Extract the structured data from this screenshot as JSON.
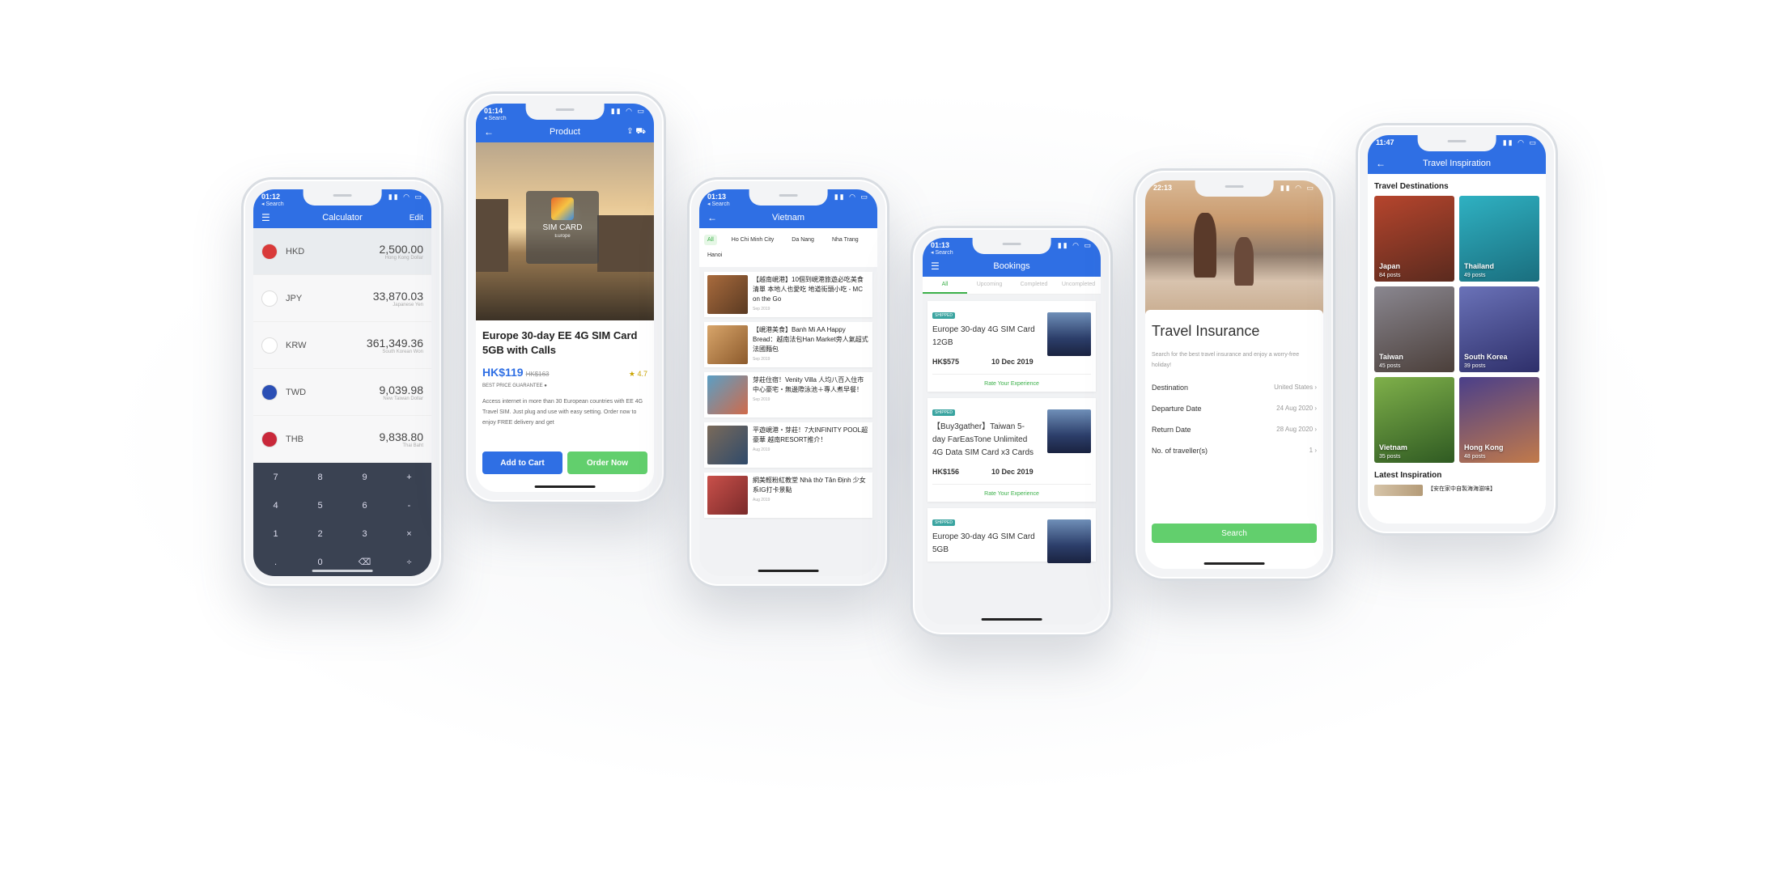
{
  "calculator": {
    "status_time": "01:12",
    "status_sub": "◂ Search",
    "title": "Calculator",
    "edit_label": "Edit",
    "rows": [
      {
        "code": "HKD",
        "amount": "2,500.00",
        "caption": "Hong Kong Dollar",
        "color": "#d93a3a"
      },
      {
        "code": "JPY",
        "amount": "33,870.03",
        "caption": "Japanese Yen",
        "color": "#ffffff"
      },
      {
        "code": "KRW",
        "amount": "361,349.36",
        "caption": "South Korean Won",
        "color": "#ffffff"
      },
      {
        "code": "TWD",
        "amount": "9,039.98",
        "caption": "New Taiwan Dollar",
        "color": "#2b4fb5"
      },
      {
        "code": "THB",
        "amount": "9,838.80",
        "caption": "Thai Baht",
        "color": "#c9283a"
      }
    ],
    "keys": [
      "7",
      "8",
      "9",
      "+",
      "4",
      "5",
      "6",
      "-",
      "1",
      "2",
      "3",
      "×",
      ".",
      "0",
      "⌫",
      "÷"
    ]
  },
  "product": {
    "status_time": "01:14",
    "status_sub": "◂ Search",
    "title": "Product",
    "sim_label": "SIM CARD",
    "sim_sub": "Europe",
    "name": "Europe 30-day EE 4G SIM Card 5GB with Calls",
    "price": "HK$119",
    "old_price": "HK$163",
    "rating": "★ 4.7",
    "guarantee": "BEST PRICE GUARANTEE",
    "description": "Access internet in more than 30 European countries with EE 4G Travel SIM. Just plug and use with easy setting. Order now to enjoy FREE delivery and get",
    "add_to_cart": "Add to Cart",
    "order_now": "Order Now",
    "colors": {
      "add": "#2f6fe4",
      "order": "#62cf6d"
    }
  },
  "vietnam": {
    "status_time": "01:13",
    "status_sub": "◂ Search",
    "title": "Vietnam",
    "chips": [
      "All",
      "Ho Chi Minh City",
      "Da Nang",
      "Nha Trang",
      "Hanoi"
    ],
    "articles": [
      {
        "title": "【越南峴港】10個到峴港旅遊必吃美食清單 本地人也愛吃 地道街頭小吃 - MC on the Go",
        "date": "Sep 2019"
      },
      {
        "title": "【峴港美食】Banh Mi AA Happy Bread：越南法包Han Market旁人氣超式法國麵包",
        "date": "Sep 2019"
      },
      {
        "title": "芽莊住宿！Venity Villa 人均八百入住市中心豪宅・無邊際泳池＋專人煮早餐！",
        "date": "Sep 2019"
      },
      {
        "title": "平遊峴港・芽莊！7大INFINITY POOL超豪華 越南RESORT推介！",
        "date": "Aug 2019"
      },
      {
        "title": "網美輕粉紅教堂 Nhà thờ Tân Định 少女系IG打卡景點",
        "date": "Aug 2019"
      }
    ]
  },
  "bookings": {
    "status_time": "01:13",
    "status_sub": "◂ Search",
    "title": "Bookings",
    "tabs": [
      "All",
      "Upcoming",
      "Completed",
      "Uncompleted"
    ],
    "items": [
      {
        "tag": "SHIPPED",
        "title": "Europe 30-day 4G SIM Card 12GB",
        "price": "HK$575",
        "date": "10 Dec 2019",
        "rate": "Rate Your Experience"
      },
      {
        "tag": "SHIPPED",
        "title": "【Buy3gather】Taiwan 5-day FarEasTone Unlimited 4G Data SIM Card x3 Cards",
        "price": "HK$156",
        "date": "10 Dec 2019",
        "rate": "Rate Your Experience"
      },
      {
        "tag": "SHIPPED",
        "title": "Europe 30-day 4G SIM Card 5GB",
        "price": "",
        "date": "",
        "rate": ""
      }
    ]
  },
  "insurance": {
    "status_time": "22:13",
    "title": "Travel Insurance",
    "subtitle": "Search for the best travel insurance and enjoy a worry-free holiday!",
    "rows": [
      {
        "label": "Destination",
        "value": "United States"
      },
      {
        "label": "Departure Date",
        "value": "24 Aug 2020"
      },
      {
        "label": "Return Date",
        "value": "28 Aug 2020"
      },
      {
        "label": "No. of traveller(s)",
        "value": "1"
      }
    ],
    "search_label": "Search"
  },
  "inspiration": {
    "status_time": "11:47",
    "title": "Travel Inspiration",
    "section_destinations": "Travel Destinations",
    "destinations": [
      {
        "name": "Japan",
        "posts": "84 posts",
        "colors": [
          "#b6452d",
          "#5a2a1e"
        ]
      },
      {
        "name": "Thailand",
        "posts": "49 posts",
        "colors": [
          "#2fb1c2",
          "#1a6e7e"
        ]
      },
      {
        "name": "Taiwan",
        "posts": "45 posts",
        "colors": [
          "#8a8790",
          "#4b3f3a"
        ]
      },
      {
        "name": "South Korea",
        "posts": "39 posts",
        "colors": [
          "#6a72b8",
          "#2e2f6a"
        ]
      },
      {
        "name": "Vietnam",
        "posts": "35 posts",
        "colors": [
          "#7fb04a",
          "#2f5a22"
        ]
      },
      {
        "name": "Hong Kong",
        "posts": "48 posts",
        "colors": [
          "#4a3f8a",
          "#c27a4a"
        ]
      }
    ],
    "section_latest": "Latest Inspiration",
    "latest_title": "【安在家中自製海海滋味】"
  }
}
